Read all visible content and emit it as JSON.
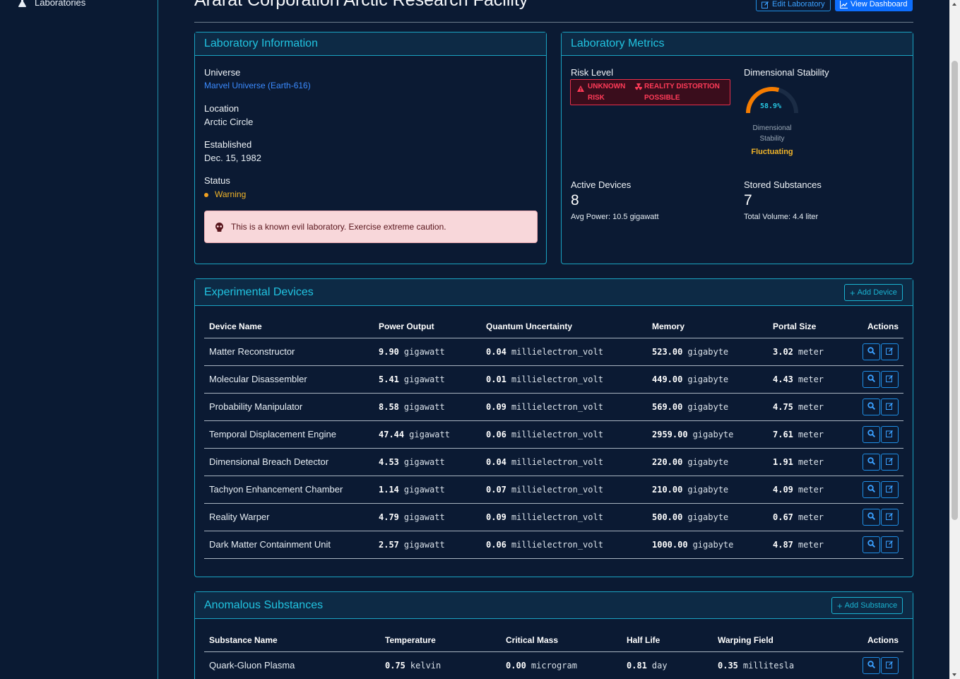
{
  "sidebar": {
    "laboratories_label": "Laboratories"
  },
  "header": {
    "title": "Ararat Corporation Arctic Research Facility",
    "edit_label": "Edit Laboratory",
    "dashboard_label": "View Dashboard"
  },
  "lab_info": {
    "heading": "Laboratory Information",
    "universe_label": "Universe",
    "universe_value": "Marvel Universe (Earth-616)",
    "location_label": "Location",
    "location_value": "Arctic Circle",
    "established_label": "Established",
    "established_value": "Dec. 15, 1982",
    "status_label": "Status",
    "status_value": "Warning",
    "alert_text": "This is a known evil laboratory. Exercise extreme caution."
  },
  "metrics": {
    "heading": "Laboratory Metrics",
    "risk_label": "Risk Level",
    "risk_line1a": "UNKNOWN",
    "risk_line2a": "RISK",
    "risk_line1b": "REALITY DISTORTION",
    "risk_line2b": "POSSIBLE",
    "stability_label": "Dimensional Stability",
    "stability_value": "58.9%",
    "stability_fraction": 0.589,
    "stability_caption1": "Dimensional",
    "stability_caption2": "Stability",
    "stability_status": "Fluctuating",
    "devices_label": "Active Devices",
    "devices_count": "8",
    "devices_sub": "Avg Power: 10.5 gigawatt",
    "substances_label": "Stored Substances",
    "substances_count": "7",
    "substances_sub": "Total Volume: 4.4 liter"
  },
  "devices": {
    "heading": "Experimental Devices",
    "add_label": "Add Device",
    "columns": [
      "Device Name",
      "Power Output",
      "Quantum Uncertainty",
      "Memory",
      "Portal Size",
      "Actions"
    ],
    "rows": [
      {
        "name": "Matter Reconstructor",
        "power": "9.90",
        "power_unit": "gigawatt",
        "qu": "0.04",
        "qu_unit": "millielectron_volt",
        "mem": "523.00",
        "mem_unit": "gigabyte",
        "portal": "3.02",
        "portal_unit": "meter"
      },
      {
        "name": "Molecular Disassembler",
        "power": "5.41",
        "power_unit": "gigawatt",
        "qu": "0.01",
        "qu_unit": "millielectron_volt",
        "mem": "449.00",
        "mem_unit": "gigabyte",
        "portal": "4.43",
        "portal_unit": "meter"
      },
      {
        "name": "Probability Manipulator",
        "power": "8.58",
        "power_unit": "gigawatt",
        "qu": "0.09",
        "qu_unit": "millielectron_volt",
        "mem": "569.00",
        "mem_unit": "gigabyte",
        "portal": "4.75",
        "portal_unit": "meter"
      },
      {
        "name": "Temporal Displacement Engine",
        "power": "47.44",
        "power_unit": "gigawatt",
        "qu": "0.06",
        "qu_unit": "millielectron_volt",
        "mem": "2959.00",
        "mem_unit": "gigabyte",
        "portal": "7.61",
        "portal_unit": "meter"
      },
      {
        "name": "Dimensional Breach Detector",
        "power": "4.53",
        "power_unit": "gigawatt",
        "qu": "0.04",
        "qu_unit": "millielectron_volt",
        "mem": "220.00",
        "mem_unit": "gigabyte",
        "portal": "1.91",
        "portal_unit": "meter"
      },
      {
        "name": "Tachyon Enhancement Chamber",
        "power": "1.14",
        "power_unit": "gigawatt",
        "qu": "0.07",
        "qu_unit": "millielectron_volt",
        "mem": "210.00",
        "mem_unit": "gigabyte",
        "portal": "4.09",
        "portal_unit": "meter"
      },
      {
        "name": "Reality Warper",
        "power": "4.79",
        "power_unit": "gigawatt",
        "qu": "0.09",
        "qu_unit": "millielectron_volt",
        "mem": "500.00",
        "mem_unit": "gigabyte",
        "portal": "0.67",
        "portal_unit": "meter"
      },
      {
        "name": "Dark Matter Containment Unit",
        "power": "2.57",
        "power_unit": "gigawatt",
        "qu": "0.06",
        "qu_unit": "millielectron_volt",
        "mem": "1000.00",
        "mem_unit": "gigabyte",
        "portal": "4.87",
        "portal_unit": "meter"
      }
    ]
  },
  "substances": {
    "heading": "Anomalous Substances",
    "add_label": "Add Substance",
    "columns": [
      "Substance Name",
      "Temperature",
      "Critical Mass",
      "Half Life",
      "Warping Field",
      "Actions"
    ],
    "rows": [
      {
        "name": "Quark-Gluon Plasma",
        "temp": "0.75",
        "temp_unit": "kelvin",
        "mass": "0.00",
        "mass_unit": "microgram",
        "half": "0.81",
        "half_unit": "day",
        "warp": "0.35",
        "warp_unit": "millitesla"
      }
    ]
  },
  "colors": {
    "accent": "#21c3e0",
    "primary": "#0d6efd",
    "warning": "#f0b429",
    "danger": "#ff3b58"
  }
}
